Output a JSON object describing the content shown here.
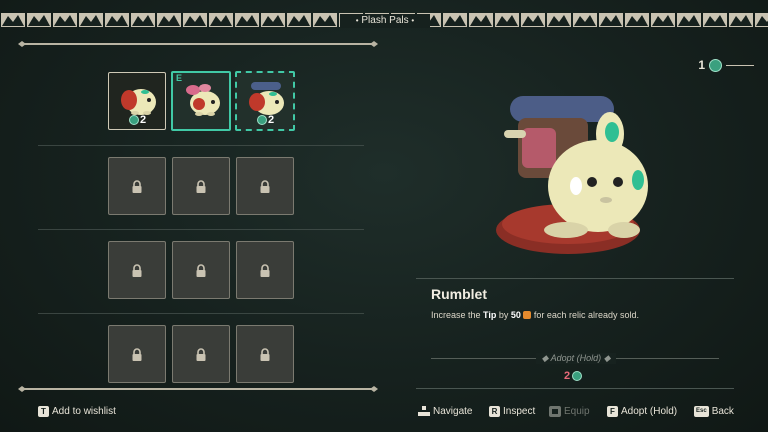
{
  "header": {
    "title": "Plash Pals"
  },
  "grid": {
    "owned": [
      {
        "name": "pal-slot-1",
        "count": "2",
        "state": "owned"
      },
      {
        "name": "pal-slot-2",
        "marker": "E",
        "state": "selected"
      },
      {
        "name": "pal-slot-3",
        "count": "2",
        "state": "owned-dashed"
      }
    ],
    "locked_rows": 3,
    "locked_cols": 3
  },
  "currency": {
    "amount": "1"
  },
  "detail": {
    "name": "Rumblet",
    "desc_prefix": "Increase the ",
    "desc_bold": "Tip",
    "desc_mid": " by ",
    "desc_value": "50",
    "desc_suffix": " for each relic already sold.",
    "adopt_label": "Adopt (Hold)",
    "adopt_cost": "2"
  },
  "bottom": {
    "wishlist_key": "T",
    "wishlist_label": "Add to wishlist",
    "navigate_label": "Navigate",
    "inspect_key": "R",
    "inspect_label": "Inspect",
    "equip_label": "Equip",
    "adopt_key": "F",
    "adopt_label": "Adopt (Hold)",
    "back_key": "Esc",
    "back_label": "Back"
  }
}
